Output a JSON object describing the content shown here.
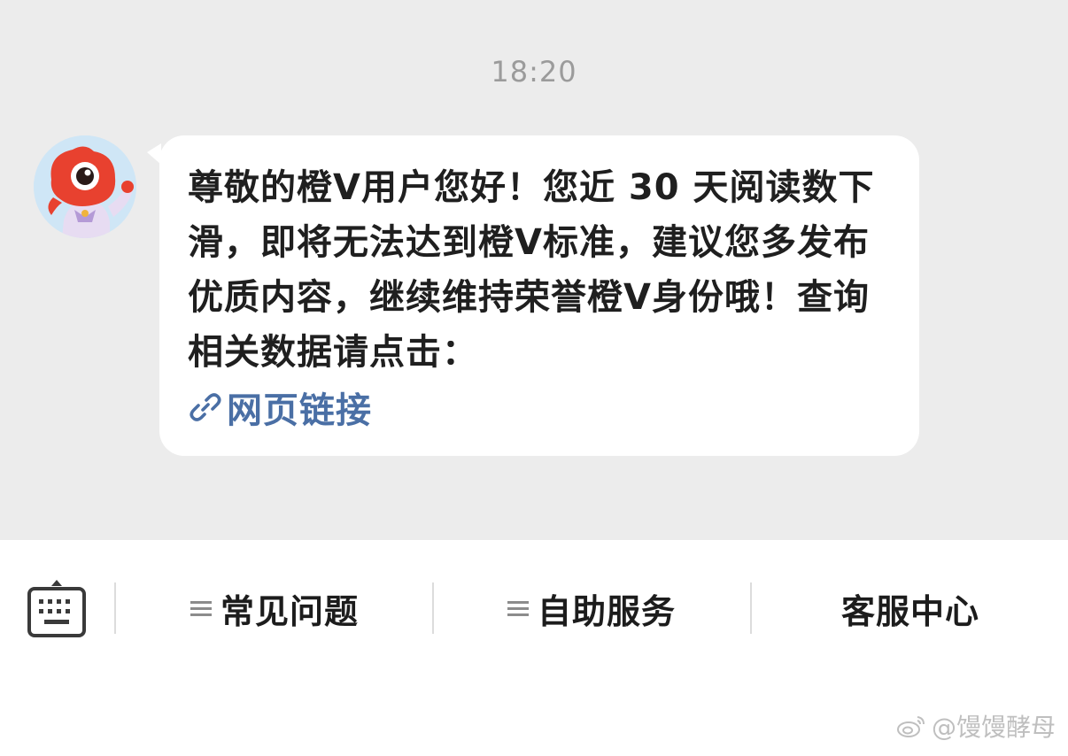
{
  "chat": {
    "timestamp": "18:20",
    "message": {
      "text": "尊敬的橙V用户您好！您近 30 天阅读数下滑，即将无法达到橙V标准，建议您多发布优质内容，继续维持荣誉橙V身份哦！查询相关数据请点击：",
      "link_label": "网页链接"
    }
  },
  "bottom_bar": {
    "items": [
      {
        "label": "常见问题",
        "icon": "menu-lines-icon"
      },
      {
        "label": "自助服务",
        "icon": "menu-lines-icon"
      },
      {
        "label": "客服中心"
      }
    ]
  },
  "watermark": {
    "text": "@馒馒酵母"
  },
  "colors": {
    "chat_background": "#ececec",
    "bubble": "#ffffff",
    "link": "#4a6fa5",
    "timestamp": "#9b9b9b"
  }
}
